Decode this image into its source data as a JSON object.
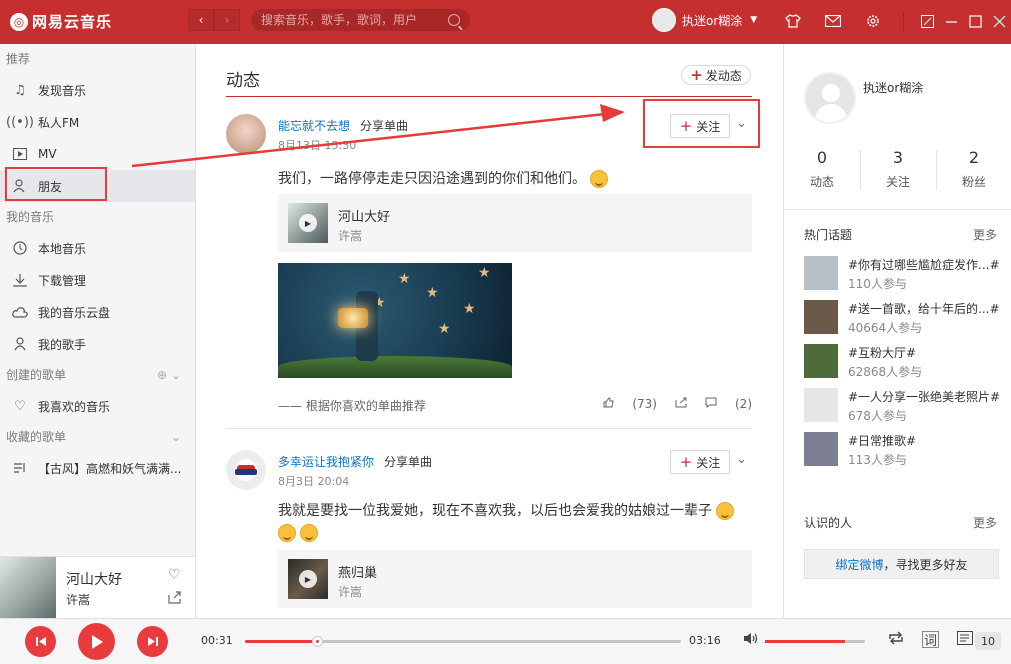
{
  "titlebar": {
    "app_name": "网易云音乐",
    "logo_glyph": "◎",
    "search_placeholder": "搜索音乐，歌手，歌词，用户",
    "username": "执迷or糊涂",
    "nav_back": "‹",
    "nav_forward": "›"
  },
  "sidebar": {
    "sections": {
      "recommend": "推荐",
      "my_music": "我的音乐",
      "created": "创建的歌单",
      "collected": "收藏的歌单"
    },
    "recommend_items": [
      {
        "label": "发现音乐",
        "icon": "music-note-icon"
      },
      {
        "label": "私人FM",
        "icon": "radio-icon"
      },
      {
        "label": "MV",
        "icon": "video-icon"
      },
      {
        "label": "朋友",
        "icon": "friends-icon"
      }
    ],
    "my_music_items": [
      {
        "label": "本地音乐",
        "icon": "local-music-icon"
      },
      {
        "label": "下载管理",
        "icon": "download-icon"
      },
      {
        "label": "我的音乐云盘",
        "icon": "cloud-icon"
      },
      {
        "label": "我的歌手",
        "icon": "singer-icon"
      }
    ],
    "created_items": [
      {
        "label": "我喜欢的音乐",
        "icon": "heart-icon"
      }
    ],
    "collected_items": [
      {
        "label": "【古风】高燃和妖气满满...",
        "icon": "playlist-icon"
      }
    ]
  },
  "now_playing": {
    "title": "河山大好",
    "artist": "许嵩"
  },
  "main": {
    "title": "动态",
    "post_button": "发动态",
    "feeds": [
      {
        "user": "能忘就不去想",
        "action": "分享单曲",
        "time": "8月13日 15:30",
        "text": "我们，一路停停走走只因沿途遇到的你们和他们。",
        "song_title": "河山大好",
        "song_artist": "许嵩",
        "recommend": "—— 根据你喜欢的单曲推荐",
        "likes": "(73)",
        "comments": "(2)",
        "follow": "关注"
      },
      {
        "user": "多幸运让我抱紧你",
        "action": "分享单曲",
        "time": "8月3日 20:04",
        "text": "我就是要找一位我爱她，现在不喜欢我，以后也会爱我的姑娘过一辈子",
        "song_title": "燕归巢",
        "song_artist": "许嵩",
        "follow": "关注"
      }
    ]
  },
  "right_panel": {
    "username": "执迷or糊涂",
    "stats": [
      {
        "num": "0",
        "label": "动态"
      },
      {
        "num": "3",
        "label": "关注"
      },
      {
        "num": "2",
        "label": "粉丝"
      }
    ],
    "hot_topics_title": "热门话题",
    "more": "更多",
    "topics": [
      {
        "title": "#你有过哪些尴尬症发作...#",
        "count": "110人参与",
        "color": "#b8bfc4"
      },
      {
        "title": "#送一首歌，给十年后的...#",
        "count": "40664人参与",
        "color": "#6b5a4a"
      },
      {
        "title": "#互粉大厅#",
        "count": "62868人参与",
        "color": "#4f6b3a"
      },
      {
        "title": "#一人分享一张绝美老照片#",
        "count": "678人参与",
        "color": "#e7e7e7"
      },
      {
        "title": "#日常推歌#",
        "count": "113人参与",
        "color": "#7b7f8f"
      }
    ],
    "known_people_title": "认识的人",
    "weibo_link": "绑定微博",
    "weibo_rest": "，寻找更多好友"
  },
  "player": {
    "current_time": "00:31",
    "total_time": "03:16",
    "progress": 0.165,
    "volume": 0.8,
    "playlist_count": "10",
    "lyrics_btn": "词"
  },
  "colors": {
    "brand_red": "#c62f2f",
    "accent_red": "#e83c3c",
    "link_blue": "#0c73c2",
    "highlight_box": "#e53b3b"
  }
}
